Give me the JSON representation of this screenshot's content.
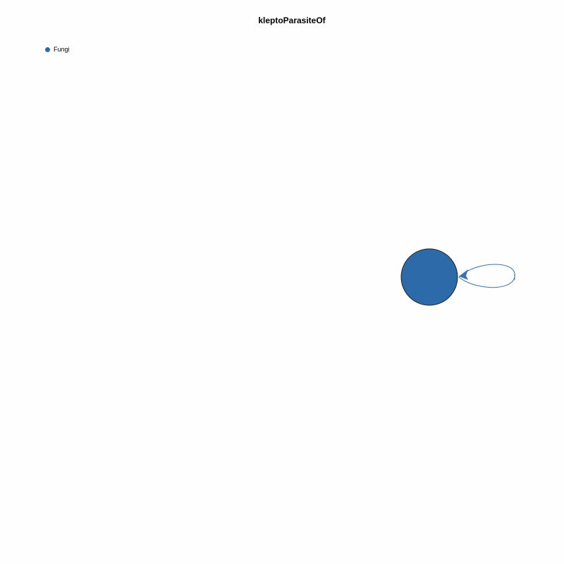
{
  "title": "kleptoParasiteOf",
  "legend": [
    {
      "label": "Fungi",
      "color": "#2d6aaa"
    }
  ],
  "graph": {
    "nodes": [
      {
        "id": "fungi",
        "group": "Fungi",
        "color": "#2d6aaa"
      }
    ],
    "edges": [
      {
        "source": "fungi",
        "target": "fungi",
        "type": "self-loop",
        "color": "#3c73ad"
      }
    ]
  }
}
